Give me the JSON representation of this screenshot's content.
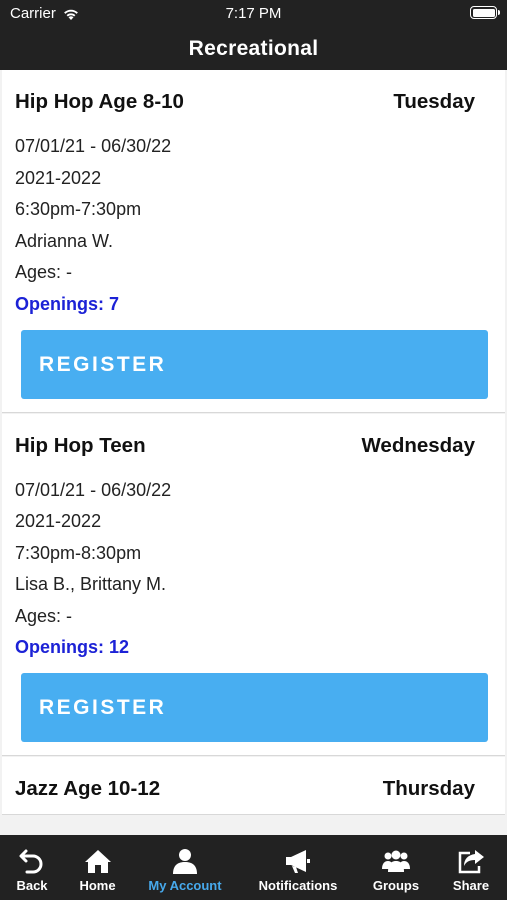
{
  "status_bar": {
    "carrier": "Carrier",
    "time": "7:17 PM",
    "battery_level": 1.0
  },
  "nav": {
    "title": "Recreational"
  },
  "classes": [
    {
      "title": "Hip Hop Age 8-10",
      "day": "Tuesday",
      "dates": "07/01/21 - 06/30/22",
      "season": "2021-2022",
      "time": "6:30pm-7:30pm",
      "instructor": "Adrianna W.",
      "ages": "Ages: -",
      "openings": "Openings: 7",
      "button": "REGISTER"
    },
    {
      "title": "Hip Hop Teen",
      "day": "Wednesday",
      "dates": "07/01/21 - 06/30/22",
      "season": "2021-2022",
      "time": "7:30pm-8:30pm",
      "instructor": "Lisa B., Brittany M.",
      "ages": "Ages: -",
      "openings": "Openings: 12",
      "button": "REGISTER"
    },
    {
      "title": "Jazz Age 10-12",
      "day": "Thursday"
    }
  ],
  "tabs": [
    {
      "label": "Back",
      "icon": "back-icon"
    },
    {
      "label": "Home",
      "icon": "home-icon"
    },
    {
      "label": "My Account",
      "icon": "account-icon",
      "active": true
    },
    {
      "label": "Notifications",
      "icon": "megaphone-icon"
    },
    {
      "label": "Groups",
      "icon": "groups-icon"
    },
    {
      "label": "Share",
      "icon": "share-icon"
    }
  ],
  "colors": {
    "bar_bg": "#222222",
    "button_bg": "#48aef1",
    "openings_text": "#1c22d6",
    "active_tab": "#47a9ec"
  }
}
